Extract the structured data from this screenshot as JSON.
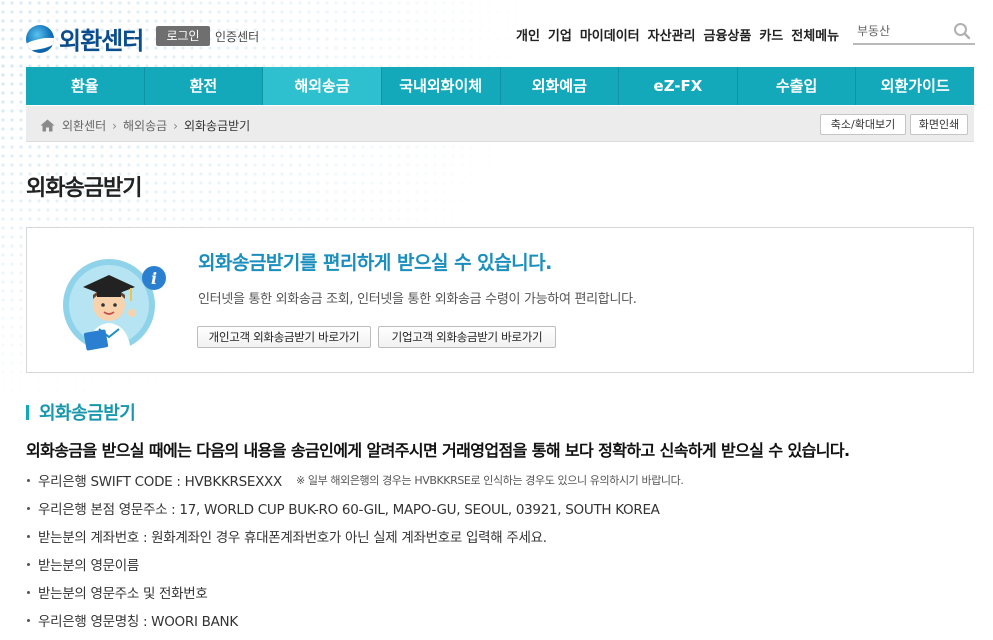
{
  "header": {
    "logo_text": "외환센터",
    "login_label": "로그인",
    "cert_label": "인증센터",
    "top_nav": [
      "개인",
      "기업",
      "마이데이터",
      "자산관리",
      "금융상품",
      "카드",
      "전체메뉴"
    ],
    "search": {
      "value": "부동산",
      "icon": "search-icon"
    }
  },
  "gnb": {
    "items": [
      "환율",
      "환전",
      "해외송금",
      "국내외화이체",
      "외화예금",
      "eZ-FX",
      "수출입",
      "외환가이드"
    ],
    "active_index": 2,
    "color": "#13a9bb"
  },
  "breadcrumb": {
    "items": [
      "외환센터",
      "해외송금",
      "외화송금받기"
    ],
    "zoom_label": "축소/확대보기",
    "print_label": "화면인쇄"
  },
  "page": {
    "title": "외화송금받기"
  },
  "info": {
    "headline": "외화송금받기를 편리하게 받으실 수 있습니다.",
    "description": "인터넷을 통한 외화송금 조회, 인터넷을 통한 외화송금 수령이 가능하여 편리합니다.",
    "personal_button": "개인고객 외화송금받기 바로가기",
    "business_button": "기업고객 외화송금받기 바로가기",
    "headline_color": "#1a8ebd"
  },
  "section": {
    "title": "외화송금받기",
    "lead": "외화송금을 받으실 때에는 다음의 내용을 송금인에게 알려주시면 거래영업점을 통해 보다 정확하고 신속하게 받으실 수 있습니다.",
    "items": [
      {
        "text": "우리은행 SWIFT CODE : HVBKKRSEXXX",
        "note": "※ 일부 해외은행의 경우는 HVBKKRSE로 인식하는 경우도 있으니 유의하시기 바랍니다."
      },
      {
        "text": "우리은행 본점 영문주소 : 17, WORLD CUP BUK-RO 60-GIL, MAPO-GU, SEOUL, 03921, SOUTH KOREA"
      },
      {
        "text": "받는분의 계좌번호 : 원화계좌인 경우 휴대폰계좌번호가 아닌 실제 계좌번호로 입력해 주세요."
      },
      {
        "text": "받는분의 영문이름"
      },
      {
        "text": "받는분의 영문주소 및 전화번호"
      },
      {
        "text": "우리은행 영문명칭 : WOORI BANK"
      }
    ]
  }
}
